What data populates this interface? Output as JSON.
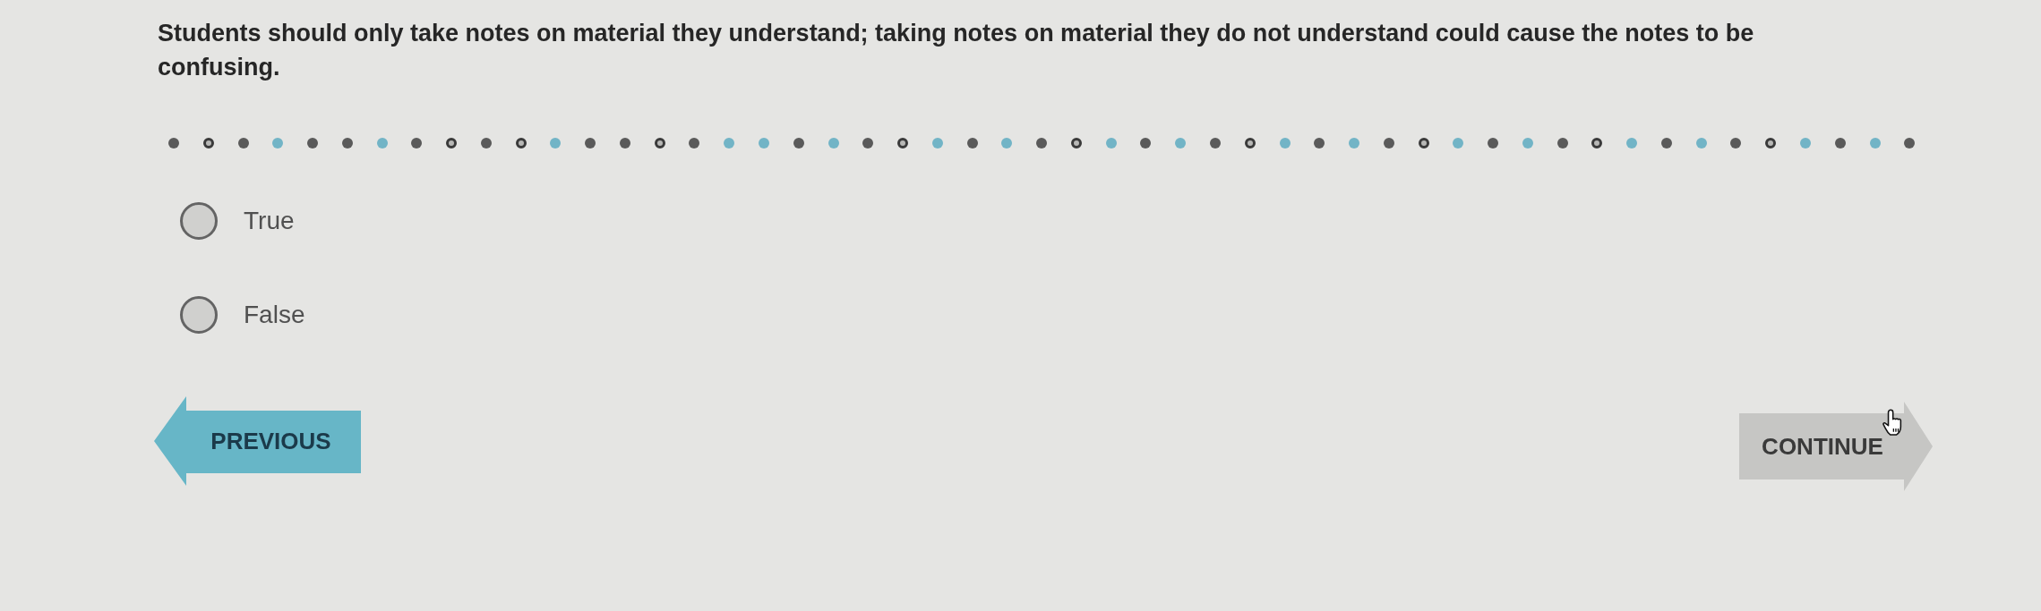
{
  "question": {
    "text": "Students should only take notes on material they understand; taking notes on material they do not understand could cause the notes to be confusing."
  },
  "progress": [
    {
      "kind": "filled",
      "color": "#5a5a5a"
    },
    {
      "kind": "ring",
      "color": "#3a3a3a"
    },
    {
      "kind": "filled",
      "color": "#5a5a5a"
    },
    {
      "kind": "filled",
      "color": "#72b4c6"
    },
    {
      "kind": "filled",
      "color": "#5a5a5a"
    },
    {
      "kind": "filled",
      "color": "#5a5a5a"
    },
    {
      "kind": "filled",
      "color": "#72b4c6"
    },
    {
      "kind": "filled",
      "color": "#5a5a5a"
    },
    {
      "kind": "ring",
      "color": "#3a3a3a"
    },
    {
      "kind": "filled",
      "color": "#5a5a5a"
    },
    {
      "kind": "ring",
      "color": "#3a3a3a"
    },
    {
      "kind": "filled",
      "color": "#72b4c6"
    },
    {
      "kind": "filled",
      "color": "#5a5a5a"
    },
    {
      "kind": "filled",
      "color": "#5a5a5a"
    },
    {
      "kind": "ring",
      "color": "#3a3a3a"
    },
    {
      "kind": "filled",
      "color": "#5a5a5a"
    },
    {
      "kind": "filled",
      "color": "#72b4c6"
    },
    {
      "kind": "filled",
      "color": "#72b4c6"
    },
    {
      "kind": "filled",
      "color": "#5a5a5a"
    },
    {
      "kind": "filled",
      "color": "#72b4c6"
    },
    {
      "kind": "filled",
      "color": "#5a5a5a"
    },
    {
      "kind": "ring",
      "color": "#3a3a3a"
    },
    {
      "kind": "filled",
      "color": "#72b4c6"
    },
    {
      "kind": "filled",
      "color": "#5a5a5a"
    },
    {
      "kind": "filled",
      "color": "#72b4c6"
    },
    {
      "kind": "filled",
      "color": "#5a5a5a"
    },
    {
      "kind": "ring",
      "color": "#3a3a3a"
    },
    {
      "kind": "filled",
      "color": "#72b4c6"
    },
    {
      "kind": "filled",
      "color": "#5a5a5a"
    },
    {
      "kind": "filled",
      "color": "#72b4c6"
    },
    {
      "kind": "filled",
      "color": "#5a5a5a"
    },
    {
      "kind": "ring",
      "color": "#3a3a3a"
    },
    {
      "kind": "filled",
      "color": "#72b4c6"
    },
    {
      "kind": "filled",
      "color": "#5a5a5a"
    },
    {
      "kind": "filled",
      "color": "#72b4c6"
    },
    {
      "kind": "filled",
      "color": "#5a5a5a"
    },
    {
      "kind": "ring",
      "color": "#3a3a3a"
    },
    {
      "kind": "filled",
      "color": "#72b4c6"
    },
    {
      "kind": "filled",
      "color": "#5a5a5a"
    },
    {
      "kind": "filled",
      "color": "#72b4c6"
    },
    {
      "kind": "filled",
      "color": "#5a5a5a"
    },
    {
      "kind": "ring",
      "color": "#3a3a3a"
    },
    {
      "kind": "filled",
      "color": "#72b4c6"
    },
    {
      "kind": "filled",
      "color": "#5a5a5a"
    },
    {
      "kind": "filled",
      "color": "#72b4c6"
    },
    {
      "kind": "filled",
      "color": "#5a5a5a"
    },
    {
      "kind": "ring",
      "color": "#3a3a3a"
    },
    {
      "kind": "filled",
      "color": "#72b4c6"
    },
    {
      "kind": "filled",
      "color": "#5a5a5a"
    },
    {
      "kind": "filled",
      "color": "#72b4c6"
    },
    {
      "kind": "filled",
      "color": "#5a5a5a"
    }
  ],
  "options": [
    {
      "label": "True",
      "selected": false
    },
    {
      "label": "False",
      "selected": false
    }
  ],
  "buttons": [
    {
      "label": "PREVIOUS",
      "kind": "back",
      "disabled": false
    },
    {
      "label": "CONTINUE",
      "kind": "forward",
      "disabled": true
    }
  ]
}
